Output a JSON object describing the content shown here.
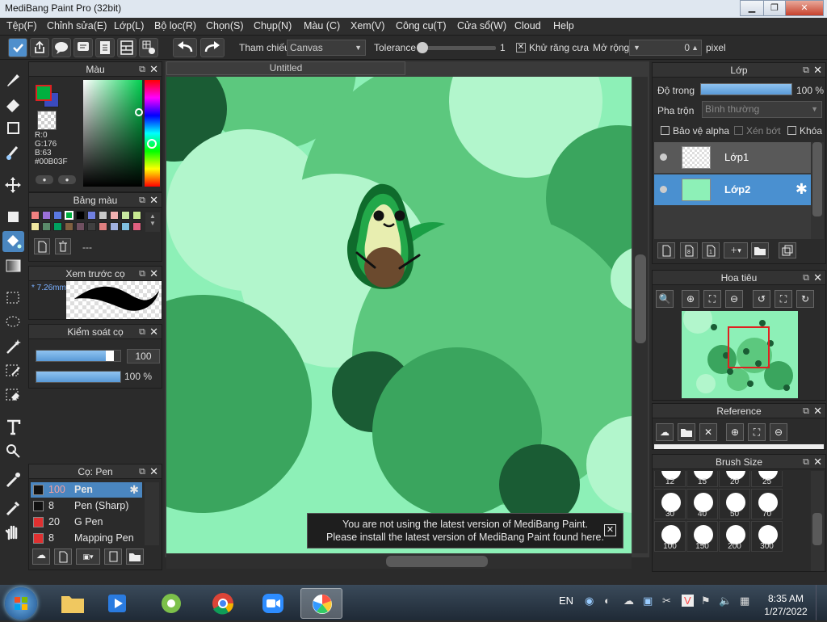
{
  "window": {
    "title": "MediBang Paint Pro (32bit)"
  },
  "menu": [
    "Tệp(F)",
    "Chỉnh sửa(E)",
    "Lớp(L)",
    "Bộ lọc(R)",
    "Chọn(S)",
    "Chụp(N)",
    "Màu (C)",
    "Xem(V)",
    "Công cụ(T)",
    "Cửa sổ(W)",
    "Cloud",
    "Help"
  ],
  "toolbar": {
    "reference_label": "Tham chiếu",
    "reference_value": "Canvas",
    "tolerance_label": "Tolerance",
    "tolerance_value": "1",
    "tolerance_fraction": 0.02,
    "antialias_label": "Khử răng cưa",
    "expand_label": "Mở rộng",
    "expand_value": "0",
    "expand_unit": "pixel"
  },
  "color_panel": {
    "title": "Màu",
    "r": "R:0",
    "g": "G:176",
    "b": "B:63",
    "hex": "#00B03F",
    "fg": "#00B03F",
    "bg": "#3b4bbf"
  },
  "palette_panel": {
    "title": "Bảng màu",
    "name": "---",
    "colors": [
      "#f08080",
      "#9a6fd8",
      "#5a78e0",
      "#00b03f",
      "#000000",
      "#6f7fe0",
      "#c8c8c8",
      "#f0b0b0",
      "#c8e8a0",
      "#c8e890",
      "#f0e8a0",
      "#5a8a6a",
      "#00a060",
      "#806040",
      "#705060",
      "#404040",
      "#e08080",
      "#a0b0e0",
      "#80c0e0",
      "#e06080"
    ]
  },
  "preview_panel": {
    "title": "Xem trước cọ",
    "size": "7.26mm"
  },
  "brushctl_panel": {
    "title": "Kiểm soát cọ",
    "size": "100",
    "opacity": "100 %",
    "size_fraction": 0.92,
    "opacity_fraction": 1.0
  },
  "brush_panel": {
    "title": "Cọ: Pen",
    "items": [
      {
        "n": "100",
        "name": "Pen",
        "color": "#111111"
      },
      {
        "n": "8",
        "name": "Pen (Sharp)",
        "color": "#111111"
      },
      {
        "n": "20",
        "name": "G Pen",
        "color": "#e03030"
      },
      {
        "n": "8",
        "name": "Mapping Pen",
        "color": "#e03030"
      }
    ]
  },
  "canvas": {
    "tab": "Untitled"
  },
  "notice": {
    "line1": "You are not using the latest version of MediBang Paint.",
    "line2": "Please install the latest version of MediBang Paint found here."
  },
  "layer_panel": {
    "title": "Lớp",
    "opacity_label": "Độ trong",
    "opacity_value": "100 %",
    "opacity_fraction": 1.0,
    "blend_label": "Pha trộn",
    "blend_value": "Bình thường",
    "protect_alpha": "Bảo vệ alpha",
    "clip": "Xén bớt",
    "lock": "Khóa",
    "layers": [
      {
        "name": "Lớp1",
        "selected": false
      },
      {
        "name": "Lớp2",
        "selected": true
      }
    ]
  },
  "navigator_panel": {
    "title": "Hoa tiêu"
  },
  "reference_panel": {
    "title": "Reference"
  },
  "brushsize_panel": {
    "title": "Brush Size",
    "sizes_top": [
      "12",
      "15",
      "20",
      "25"
    ],
    "sizes": [
      "30",
      "40",
      "50",
      "70",
      "100",
      "150",
      "200",
      "300"
    ]
  },
  "taskbar": {
    "lang": "EN",
    "time": "8:35 AM",
    "date": "1/27/2022"
  }
}
